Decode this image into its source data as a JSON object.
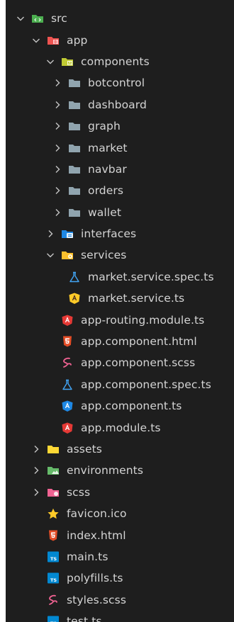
{
  "explorer": {
    "items": [
      {
        "label": "src",
        "depth": 0,
        "expanded": true,
        "folder": true,
        "icon": "src-folder-icon"
      },
      {
        "label": "app",
        "depth": 1,
        "expanded": true,
        "folder": true,
        "icon": "app-folder-icon"
      },
      {
        "label": "components",
        "depth": 2,
        "expanded": true,
        "folder": true,
        "icon": "components-folder-icon"
      },
      {
        "label": "botcontrol",
        "depth": 3,
        "expanded": false,
        "folder": true,
        "icon": "folder-icon"
      },
      {
        "label": "dashboard",
        "depth": 3,
        "expanded": false,
        "folder": true,
        "icon": "folder-icon"
      },
      {
        "label": "graph",
        "depth": 3,
        "expanded": false,
        "folder": true,
        "icon": "folder-icon"
      },
      {
        "label": "market",
        "depth": 3,
        "expanded": false,
        "folder": true,
        "icon": "folder-icon"
      },
      {
        "label": "navbar",
        "depth": 3,
        "expanded": false,
        "folder": true,
        "icon": "folder-icon"
      },
      {
        "label": "orders",
        "depth": 3,
        "expanded": false,
        "folder": true,
        "icon": "folder-icon"
      },
      {
        "label": "wallet",
        "depth": 3,
        "expanded": false,
        "folder": true,
        "icon": "folder-icon"
      },
      {
        "label": "interfaces",
        "depth": 2,
        "expanded": false,
        "folder": true,
        "icon": "interfaces-folder-icon"
      },
      {
        "label": "services",
        "depth": 2,
        "expanded": true,
        "folder": true,
        "icon": "services-folder-icon"
      },
      {
        "label": "market.service.spec.ts",
        "depth": 3,
        "folder": false,
        "icon": "test-flask-icon"
      },
      {
        "label": "market.service.ts",
        "depth": 3,
        "folder": false,
        "icon": "angular-service-icon"
      },
      {
        "label": "app-routing.module.ts",
        "depth": 2,
        "folder": false,
        "icon": "angular-routing-icon"
      },
      {
        "label": "app.component.html",
        "depth": 2,
        "folder": false,
        "icon": "html5-icon"
      },
      {
        "label": "app.component.scss",
        "depth": 2,
        "folder": false,
        "icon": "sass-icon"
      },
      {
        "label": "app.component.spec.ts",
        "depth": 2,
        "folder": false,
        "icon": "test-flask-icon"
      },
      {
        "label": "app.component.ts",
        "depth": 2,
        "folder": false,
        "icon": "angular-component-icon"
      },
      {
        "label": "app.module.ts",
        "depth": 2,
        "folder": false,
        "icon": "angular-module-icon"
      },
      {
        "label": "assets",
        "depth": 1,
        "expanded": false,
        "folder": true,
        "icon": "assets-folder-icon"
      },
      {
        "label": "environments",
        "depth": 1,
        "expanded": false,
        "folder": true,
        "icon": "environments-folder-icon"
      },
      {
        "label": "scss",
        "depth": 1,
        "expanded": false,
        "folder": true,
        "icon": "scss-folder-icon"
      },
      {
        "label": "favicon.ico",
        "depth": 1,
        "folder": false,
        "icon": "favicon-star-icon"
      },
      {
        "label": "index.html",
        "depth": 1,
        "folder": false,
        "icon": "html5-icon"
      },
      {
        "label": "main.ts",
        "depth": 1,
        "folder": false,
        "icon": "typescript-icon"
      },
      {
        "label": "polyfills.ts",
        "depth": 1,
        "folder": false,
        "icon": "typescript-icon"
      },
      {
        "label": "styles.scss",
        "depth": 1,
        "folder": false,
        "icon": "sass-icon"
      },
      {
        "label": "test.ts",
        "depth": 1,
        "folder": false,
        "icon": "typescript-icon"
      }
    ]
  },
  "colors": {
    "background": "#1e1e1e",
    "text": "#d4d4d4",
    "chevron": "#c5c5c5",
    "folder_grey": "#90a4ae",
    "angular_red": "#e53935",
    "angular_blue": "#1e88e5",
    "angular_yellow": "#ffca28",
    "html_orange": "#e44d26",
    "sass_pink": "#f06292",
    "typescript_blue": "#0288d1",
    "star_yellow": "#ffca28",
    "flask_blue": "#42a5f5"
  }
}
